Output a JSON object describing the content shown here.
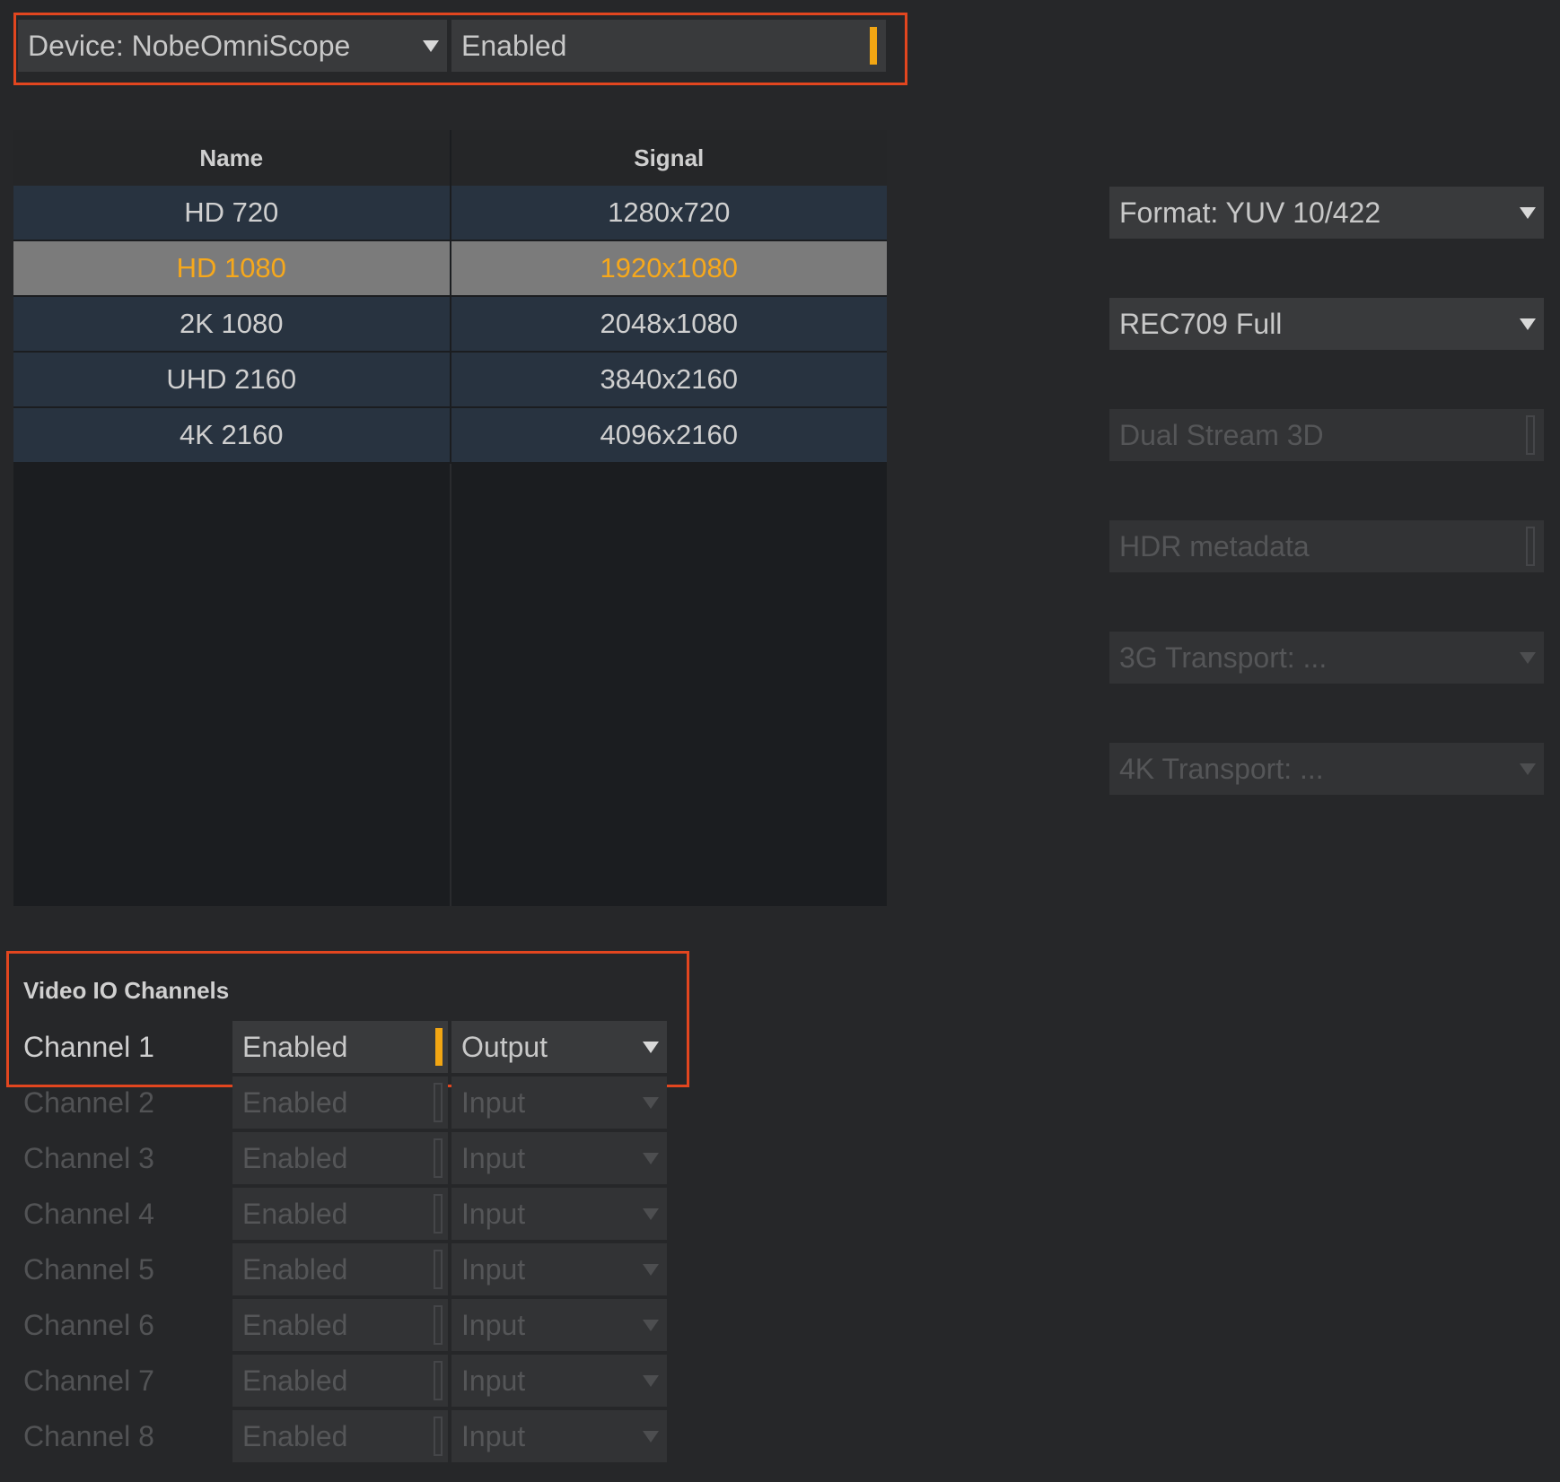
{
  "device": {
    "selector_label": "Device: NobeOmniScope",
    "enabled_label": "Enabled"
  },
  "table": {
    "headers": [
      "Name",
      "Signal"
    ],
    "rows": [
      {
        "name": "HD 720",
        "signal": "1280x720",
        "selected": false
      },
      {
        "name": "HD 1080",
        "signal": "1920x1080",
        "selected": true
      },
      {
        "name": "2K 1080",
        "signal": "2048x1080",
        "selected": false
      },
      {
        "name": "UHD 2160",
        "signal": "3840x2160",
        "selected": false
      },
      {
        "name": "4K 2160",
        "signal": "4096x2160",
        "selected": false
      }
    ]
  },
  "settings": {
    "format": "Format: YUV 10/422",
    "colorspace": "REC709 Full",
    "dual_stream": "Dual Stream 3D",
    "hdr_metadata": "HDR metadata",
    "transport_3g": "3G Transport: ...",
    "transport_4k": "4K Transport: ..."
  },
  "channels": {
    "title": "Video IO Channels",
    "items": [
      {
        "label": "Channel 1",
        "enabled": "Enabled",
        "mode": "Output",
        "active": true
      },
      {
        "label": "Channel 2",
        "enabled": "Enabled",
        "mode": "Input",
        "active": false
      },
      {
        "label": "Channel 3",
        "enabled": "Enabled",
        "mode": "Input",
        "active": false
      },
      {
        "label": "Channel 4",
        "enabled": "Enabled",
        "mode": "Input",
        "active": false
      },
      {
        "label": "Channel 5",
        "enabled": "Enabled",
        "mode": "Input",
        "active": false
      },
      {
        "label": "Channel 6",
        "enabled": "Enabled",
        "mode": "Input",
        "active": false
      },
      {
        "label": "Channel 7",
        "enabled": "Enabled",
        "mode": "Input",
        "active": false
      },
      {
        "label": "Channel 8",
        "enabled": "Enabled",
        "mode": "Input",
        "active": false
      }
    ]
  },
  "colors": {
    "accent": "#f2a613",
    "highlight_border": "#e2461f",
    "background": "#262729",
    "row_bg": "#283340",
    "selected_row_bg": "#7b7b7b"
  }
}
